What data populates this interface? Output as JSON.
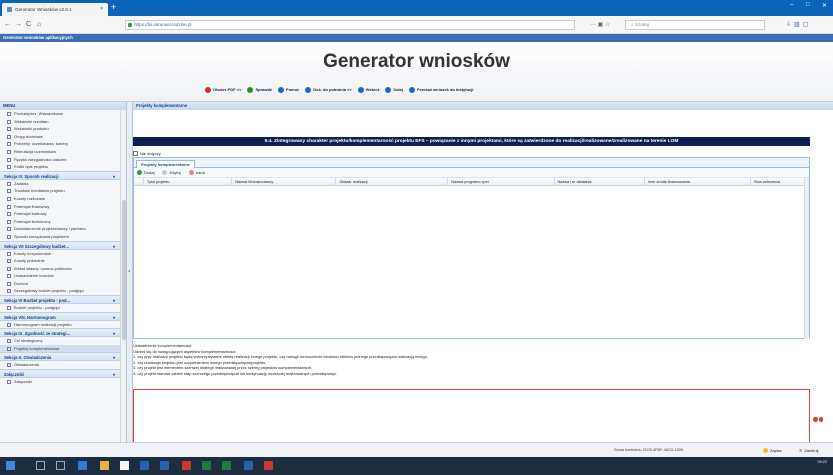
{
  "browser": {
    "tab_title": "Generator Wniosków v2.0.1",
    "tab_close": "×",
    "new_tab": "+",
    "url": "https://lsi.ukraniun.lodzkie.pl",
    "search_placeholder": "Szukaj",
    "window_controls": [
      "–",
      "□",
      "✕"
    ]
  },
  "app": {
    "titlebar": "Generator wniosków aplikacyjnych",
    "title": "Generator wniosków",
    "toolbar": [
      {
        "label": "Otwórz PDF >>",
        "color": "#c0392b"
      },
      {
        "label": "Sprawdź",
        "color": "#2e8b2e"
      },
      {
        "label": "Pomoc",
        "color": "#2468c6"
      },
      {
        "label": "Dok. do pobrania >>",
        "color": "#2468c6"
      },
      {
        "label": "Wstecz",
        "color": "#2468c6"
      },
      {
        "label": "Dalej",
        "color": "#2468c6"
      },
      {
        "label": "Przekaż wniosek do Instytucji",
        "color": "#2468c6"
      }
    ]
  },
  "sidebar": {
    "header": "MENU",
    "items": [
      {
        "type": "item",
        "label": "Produkty/rez. Wskaźnikowe"
      },
      {
        "type": "item",
        "label": "Wskaźniki rezultatu"
      },
      {
        "type": "item",
        "label": "Wskaźniki produktu"
      },
      {
        "type": "item",
        "label": "Grupy docelowe"
      },
      {
        "type": "item",
        "label": "Potrzeby, oczekiwania, bariery"
      },
      {
        "type": "item",
        "label": "Rekrutacja uczestników"
      },
      {
        "type": "item",
        "label": "Ryzyko niezgodności założeń"
      },
      {
        "type": "item",
        "label": "Krótki opis projektu"
      },
      {
        "type": "section",
        "label": "Sekcja IV. Sposób realizacji"
      },
      {
        "type": "item",
        "label": "Zadania"
      },
      {
        "type": "item",
        "label": "Trwałość rezultatów projektu"
      },
      {
        "type": "item",
        "label": "Koszty rozliczane"
      },
      {
        "type": "item",
        "label": "Potencjał finansowy"
      },
      {
        "type": "item",
        "label": "Potencjał kadrowy"
      },
      {
        "type": "item",
        "label": "Potencjał techniczny"
      },
      {
        "type": "item",
        "label": "Doświadczenie projektodawcy i partnera"
      },
      {
        "type": "item",
        "label": "Sposób zarządzania projektem"
      },
      {
        "type": "section",
        "label": "Sekcja VII Szczegółowy budżet..."
      },
      {
        "type": "item",
        "label": "Koszty bezpośrednie"
      },
      {
        "type": "item",
        "label": "Koszty pośrednie"
      },
      {
        "type": "item",
        "label": "Wkład własny i pomoc publiczna"
      },
      {
        "type": "item",
        "label": "Uzasadnienie kosztów"
      },
      {
        "type": "item",
        "label": "Dochód"
      },
      {
        "type": "item",
        "label": "Szczegółowy budżet projektu - podgląd"
      },
      {
        "type": "section",
        "label": "Sekcja VI Budżet projektu - pod..."
      },
      {
        "type": "item",
        "label": "Budżet projektu - podgląd"
      },
      {
        "type": "section",
        "label": "Sekcja VIII. Harmonogram"
      },
      {
        "type": "item",
        "label": "Harmonogram realizacji projektu"
      },
      {
        "type": "section",
        "label": "Sekcja IX. Zgodność ze strategi..."
      },
      {
        "type": "item",
        "label": "Cel strategiczny"
      },
      {
        "type": "item",
        "label": "Projekty komplementarne",
        "selected": true
      },
      {
        "type": "section",
        "label": "Sekcja X. Oświadczenia"
      },
      {
        "type": "item",
        "label": "Oświadczenia"
      },
      {
        "type": "section",
        "label": "Załączniki"
      },
      {
        "type": "item",
        "label": "Załączniki"
      }
    ]
  },
  "content": {
    "tab_title": "Projekty komplementarne",
    "section_header": "9.4. Zintegrowany charakter projektu/komplementarność projektu EFS – powiązanie z innymi projektami, które są zatwierdzone do realizacji/realizowane/zrealizowane na terenie LOM",
    "checkbox_label": "Nie dotyczy",
    "grid": {
      "tab": "Projekty komplementarne",
      "buttons": [
        {
          "label": "Dodaj",
          "color": "#2e9b2e"
        },
        {
          "label": "Edytuj",
          "color": "#c9c9c9"
        },
        {
          "label": "Usuń",
          "color": "#e08a8a"
        }
      ],
      "columns": [
        "Tytuł projektu",
        "Nazwa Wnioskodawcy",
        "Obszar realizacji",
        "Nazwa programu opei",
        "Nazwa i nr działania",
        "Inne źródła finansowania",
        "Stan wdrożenia"
      ]
    },
    "justification_title": "Uzasadnienie komplementarności",
    "justification_lines": [
      "Odnieś się do następujących aspektów komplementarności:",
      "1. czy przy realizacji projektu będą wykorzystywane efekty realizacji innego projektu, czy nastąpi wzmocnienie trwałości efektów jednego przedsięwzięcia realizacją innego,",
      "2. czy realizacja projektu jest uzupełnieniem innego przedsięwzięcia/projektu,",
      "3. czy projekt jest elementem szerszej strategii realizowanej przez szereg projektów komplementarnych,",
      "4. czy projekt stanowi ostatni etap szerszego przedsięwzięcia lub kontynuację wcześniej realizowanych przedsięwzięć."
    ]
  },
  "status": {
    "checksum": "Suma kontrolna: 2C04-4FBF-4AC0-1309",
    "save": "Zapisz",
    "close": "Zamknij"
  },
  "taskbar": {
    "time": "09:22"
  }
}
